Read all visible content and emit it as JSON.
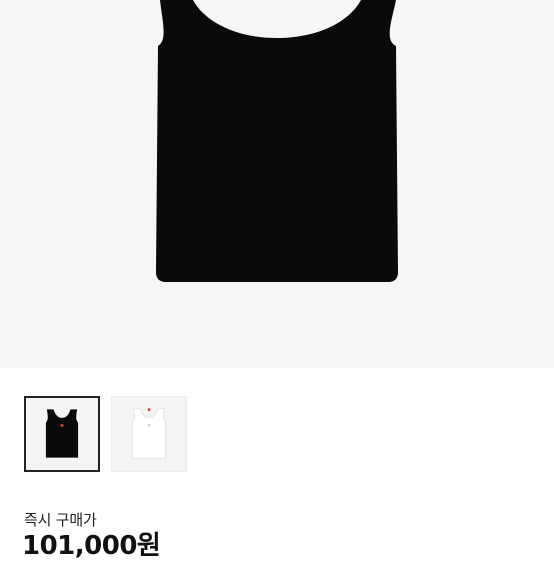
{
  "product": {
    "main_image": "black-tank-top",
    "thumbnails": [
      {
        "name": "black-tank-top",
        "color": "#0a0a0a",
        "selected": true
      },
      {
        "name": "white-tank-top",
        "color": "#f0f0f0",
        "selected": false
      }
    ]
  },
  "pricing": {
    "label": "즉시 구매가",
    "value": "101,000원"
  },
  "colors": {
    "hero_bg": "#f6f6f6",
    "tank_black": "#0a0a0a",
    "tank_white": "#f1f1f1",
    "logo_red": "#e33a2f"
  }
}
